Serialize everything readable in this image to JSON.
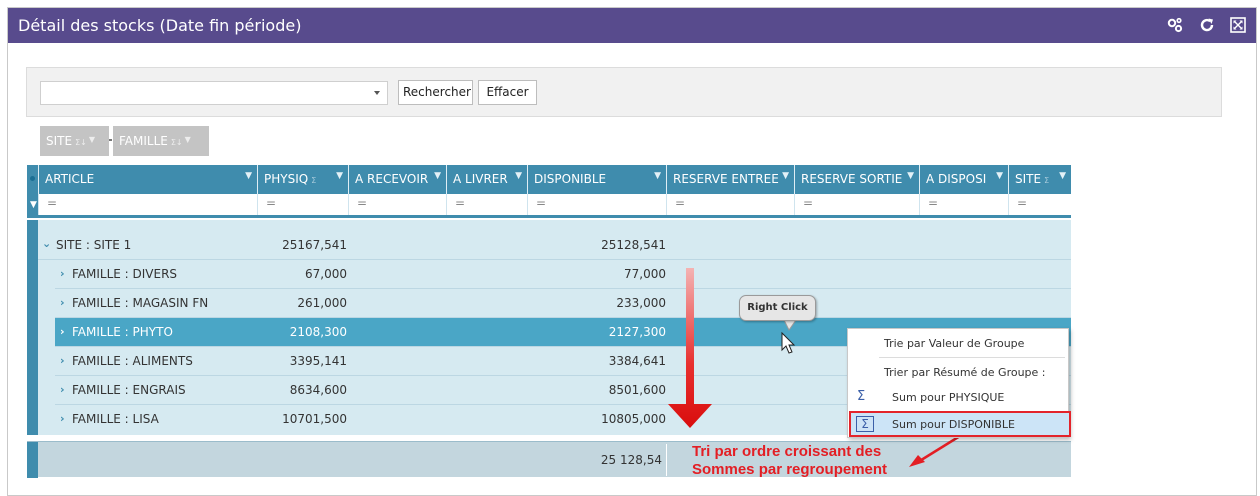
{
  "window": {
    "title": "Détail des stocks (Date fin période)",
    "icons": [
      "settings-cogs-icon",
      "refresh-icon",
      "maximize-icon"
    ]
  },
  "search": {
    "value": "",
    "search_label": "Rechercher",
    "clear_label": "Effacer"
  },
  "group_panel": {
    "chips": [
      {
        "label": "SITE",
        "sum": "Σ↓"
      },
      {
        "label": "FAMILLE",
        "sum": "Σ↓"
      }
    ]
  },
  "grid": {
    "columns": [
      "ARTICLE",
      "PHYSIQ",
      "A RECEVOIR",
      "A LIVRER",
      "DISPONIBLE",
      "RESERVE ENTREE",
      "RESERVE SORTIE",
      "A DISPOSI",
      "SITE"
    ],
    "filter_symbol": "=",
    "site_group": {
      "label": "SITE : SITE 1",
      "physique": "25167,541",
      "disponible": "25128,541"
    },
    "rows": [
      {
        "label": "FAMILLE : DIVERS",
        "physique": "67,000",
        "disponible": "77,000",
        "selected": false
      },
      {
        "label": "FAMILLE : MAGASIN FN",
        "physique": "261,000",
        "disponible": "233,000",
        "selected": false
      },
      {
        "label": "FAMILLE : PHYTO",
        "physique": "2108,300",
        "disponible": "2127,300",
        "selected": true
      },
      {
        "label": "FAMILLE : ALIMENTS",
        "physique": "3395,141",
        "disponible": "3384,641",
        "selected": false
      },
      {
        "label": "FAMILLE : ENGRAIS",
        "physique": "8634,600",
        "disponible": "8501,600",
        "selected": false
      },
      {
        "label": "FAMILLE : LISA",
        "physique": "10701,500",
        "disponible": "10805,000",
        "selected": false
      }
    ],
    "footer_total": "25 128,54"
  },
  "context_menu": {
    "items": [
      "Trie par Valeur de Groupe",
      "Trier par Résumé de Groupe :",
      "Sum pour PHYSIQUE",
      "Sum pour DISPONIBLE"
    ],
    "highlighted_index": 3
  },
  "callout": {
    "bubble": "Right Click",
    "annotation_line1": "Tri par ordre croissant des",
    "annotation_line2": "Sommes par regroupement"
  },
  "colors": {
    "titlebar": "#584b8d",
    "header": "#3f8cad",
    "row_bg": "#d6eaf1",
    "selected_row": "#4aa6c6",
    "annotation": "#e31e24"
  }
}
